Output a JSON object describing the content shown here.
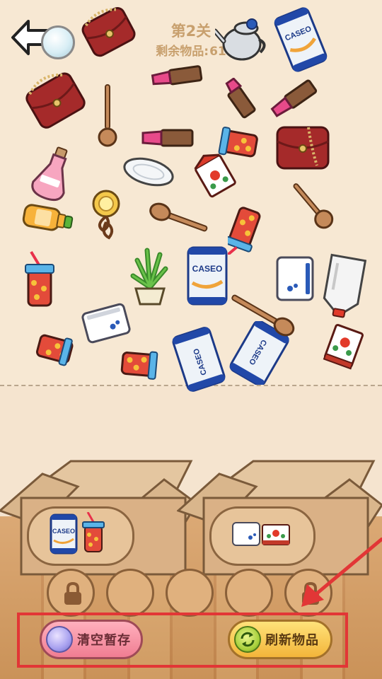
{
  "header": {
    "level_title": "第2关",
    "remaining_label": "剩余物品:",
    "remaining_count": "61"
  },
  "items": {
    "caseo_label": "CASEO"
  },
  "buttons": {
    "clear_label": "清空暂存",
    "refresh_label": "刷新物品"
  },
  "slots": {
    "total": 5,
    "locked": [
      1,
      5
    ]
  },
  "colors": {
    "highlight": "#e23636",
    "clear_button": "#f07d92",
    "refresh_button": "#f3b53a"
  }
}
